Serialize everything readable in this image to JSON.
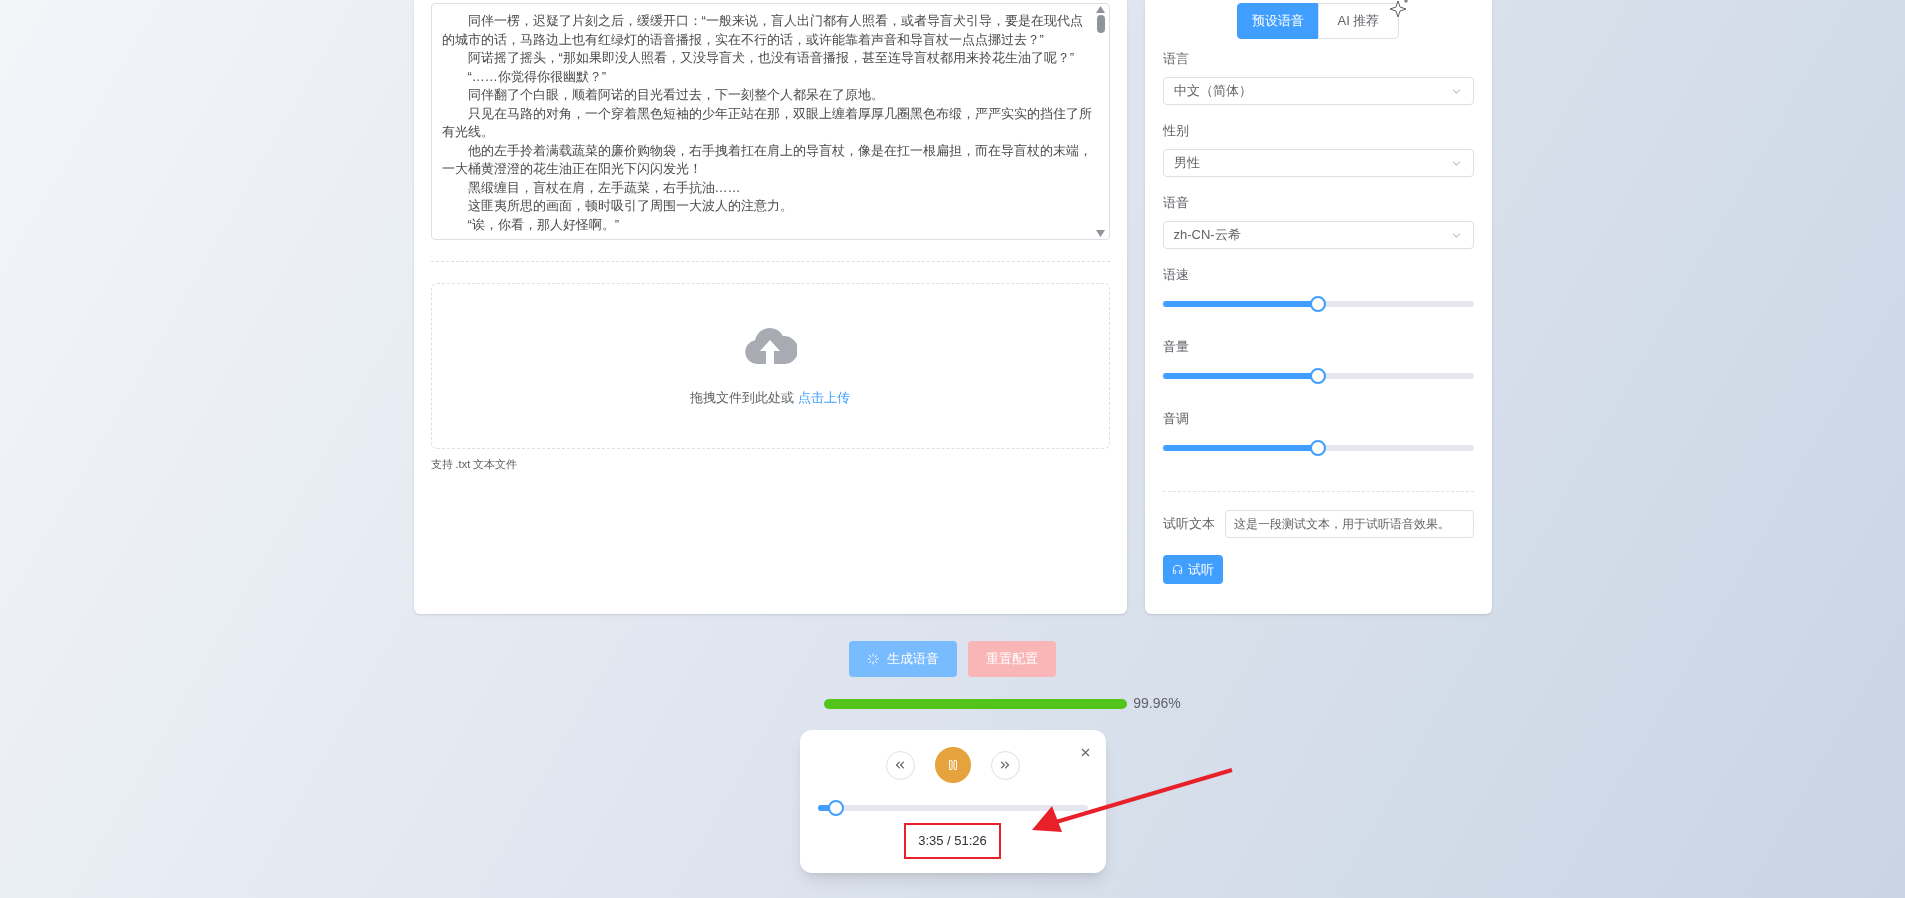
{
  "editor": {
    "paragraphs": [
      "同伴一楞，迟疑了片刻之后，缓缓开口：“一般来说，盲人出门都有人照看，或者导盲犬引导，要是在现代点的城市的话，马路边上也有红绿灯的语音播报，实在不行的话，或许能靠着声音和导盲杖一点点挪过去？”",
      "阿诺摇了摇头，“那如果即没人照看，又没导盲犬，也没有语音播报，甚至连导盲杖都用来拎花生油了呢？”",
      "“……你觉得你很幽默？”",
      "同伴翻了个白眼，顺着阿诺的目光看过去，下一刻整个人都呆在了原地。",
      "只见在马路的对角，一个穿着黑色短袖的少年正站在那，双眼上缠着厚厚几圈黑色布缎，严严实实的挡住了所有光线。",
      "他的左手拎着满载蔬菜的廉价购物袋，右手拽着扛在肩上的导盲杖，像是在扛一根扁担，而在导盲杖的末端，一大桶黄澄澄的花生油正在阳光下闪闪发光！",
      "黑缎缠目，盲杖在肩，左手蔬菜，右手抗油……",
      "这匪夷所思的画面，顿时吸引了周围一大波人的注意力。",
      "“诶，你看，那人好怪啊。”"
    ]
  },
  "upload": {
    "prompt": "拖拽文件到此处或",
    "link": "点击上传",
    "hint": "支持 .txt 文本文件"
  },
  "voice_panel": {
    "tabs": [
      {
        "label": "预设语音",
        "selected": true
      },
      {
        "label": "AI 推荐",
        "selected": false
      }
    ],
    "selects": [
      {
        "label": "语言",
        "value": "中文（简体）"
      },
      {
        "label": "性别",
        "value": "男性"
      },
      {
        "label": "语音",
        "value": "zh-CN-云希"
      }
    ],
    "sliders": [
      {
        "label": "语速",
        "level": 0.5
      },
      {
        "label": "音量",
        "level": 0.5
      },
      {
        "label": "音调",
        "level": 0.5
      }
    ],
    "preview": {
      "label": "试听文本",
      "value": "这是一段测试文本，用于试听语音效果。",
      "button": "试听"
    }
  },
  "actions": [
    {
      "kind": "generate",
      "label": "生成语音",
      "disabled": true,
      "loading": true
    },
    {
      "kind": "reset",
      "label": "重置配置",
      "disabled": true,
      "loading": false
    }
  ],
  "progress": {
    "level": 0.9996,
    "reading": "99.96%"
  },
  "player": {
    "playing": true,
    "level": 0.07,
    "time": "3:35 / 51:26"
  }
}
